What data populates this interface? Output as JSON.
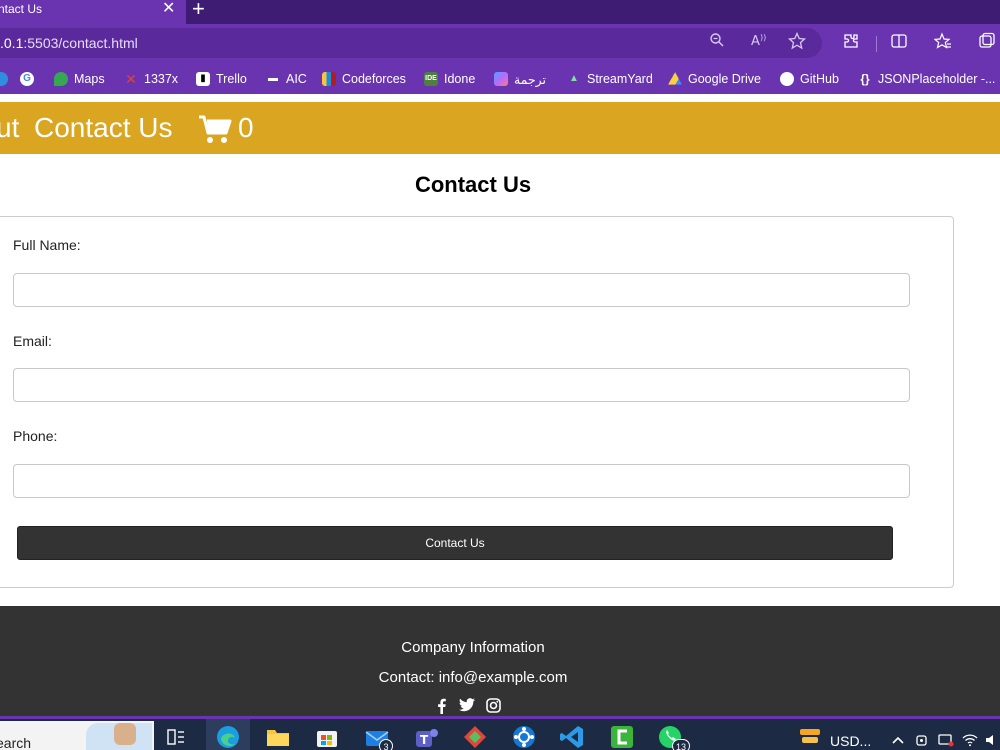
{
  "browser": {
    "tab_title": "ntact Us",
    "tab_close": "✕",
    "new_tab": "+",
    "url_host": ".0.1",
    "url_rest": ":5503/contact.html",
    "bookmarks": [
      {
        "label": "",
        "icon": "edge-icon"
      },
      {
        "label": "",
        "icon": "google-icon"
      },
      {
        "label": "Maps",
        "icon": "maps-icon"
      },
      {
        "label": "1337x",
        "icon": "x-icon"
      },
      {
        "label": "Trello",
        "icon": "trello-icon"
      },
      {
        "label": "AIC",
        "icon": "aic-icon"
      },
      {
        "label": "Codeforces",
        "icon": "codeforces-icon"
      },
      {
        "label": "Idone",
        "icon": "ideone-icon"
      },
      {
        "label": "ترجمة",
        "icon": "translate-icon"
      },
      {
        "label": "StreamYard",
        "icon": "streamyard-icon"
      },
      {
        "label": "Google Drive",
        "icon": "drive-icon"
      },
      {
        "label": "GitHub",
        "icon": "github-icon"
      },
      {
        "label": "JSONPlaceholder -...",
        "icon": "jsonplaceholder-icon"
      }
    ]
  },
  "nav": {
    "about_fragment": "ut",
    "contact": "Contact Us",
    "cart_count": "0"
  },
  "main": {
    "heading": "Contact Us",
    "fields": [
      {
        "label": "Full Name:",
        "value": "",
        "placeholder": ""
      },
      {
        "label": "Email:",
        "value": "",
        "placeholder": ""
      },
      {
        "label": "Phone:",
        "value": "",
        "placeholder": ""
      }
    ],
    "submit_label": "Contact Us"
  },
  "footer": {
    "company": "Company Information",
    "contact": "Contact: info@example.com",
    "social_icons": [
      "facebook-icon",
      "twitter-icon",
      "instagram-icon"
    ]
  },
  "taskbar": {
    "search_text": "earch",
    "tray_text": "USD...",
    "badges": {
      "mail": "3",
      "whatsapp": "13"
    }
  },
  "colors": {
    "browser_purple": "#6a34b1",
    "nav_gold": "#daa520",
    "footer_dark": "#333333",
    "button_dark": "#333333"
  }
}
